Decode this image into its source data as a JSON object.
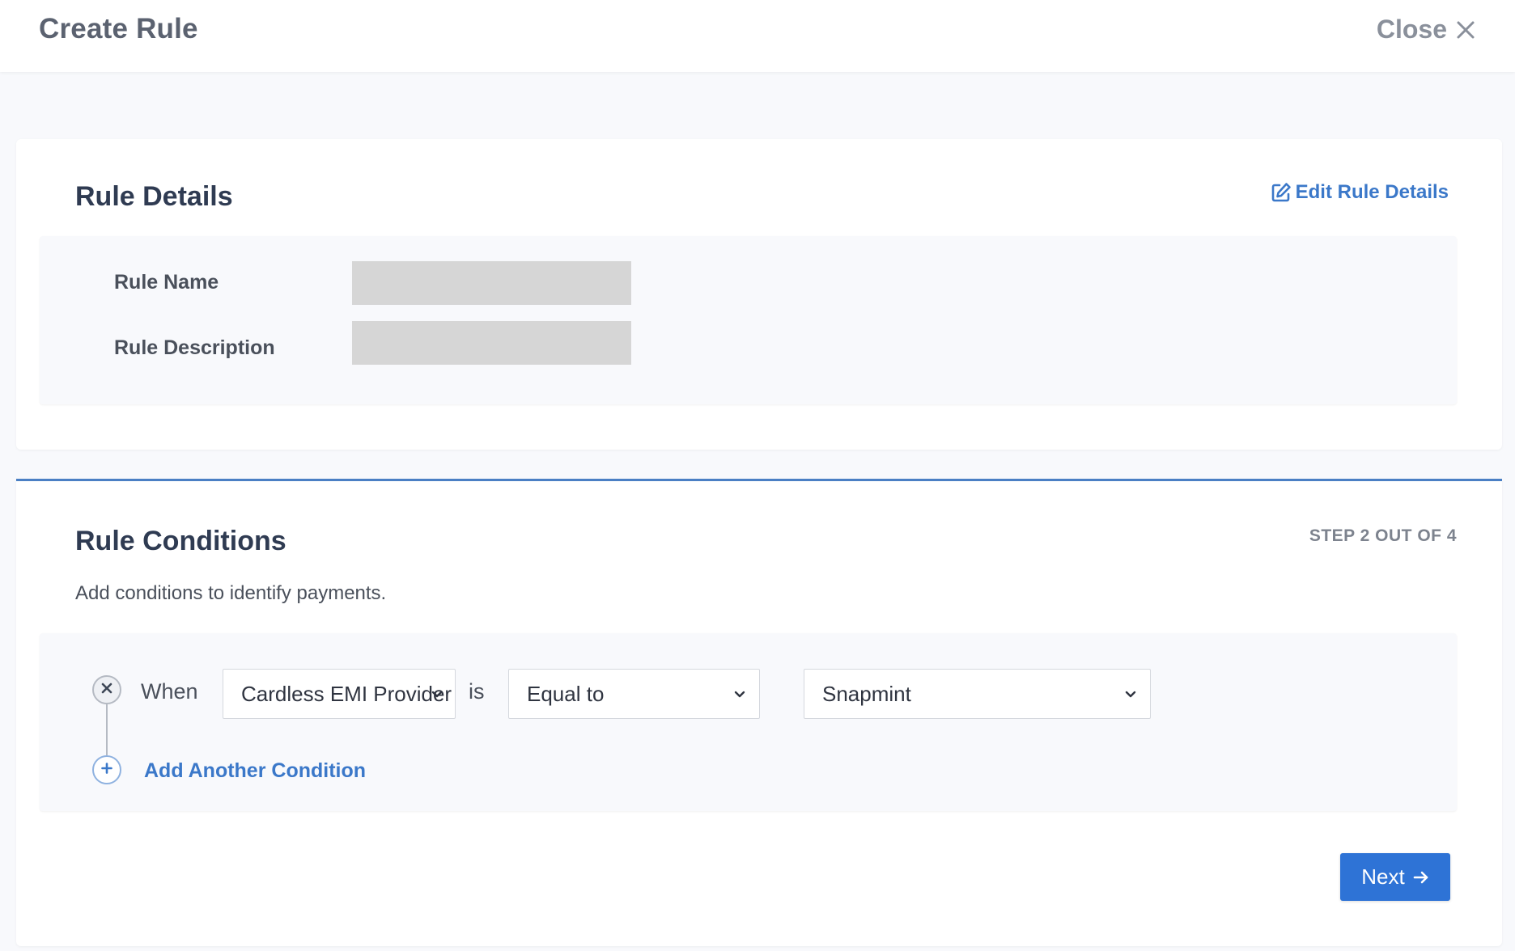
{
  "header": {
    "title": "Create Rule",
    "close_label": "Close",
    "close_icon": "close-icon"
  },
  "rule_details": {
    "title": "Rule Details",
    "edit_label": "Edit Rule Details",
    "edit_icon": "edit-icon",
    "fields": [
      {
        "label": "Rule Name",
        "value": ""
      },
      {
        "label": "Rule Description",
        "value": ""
      }
    ]
  },
  "rule_conditions": {
    "title": "Rule Conditions",
    "step": "STEP 2 OUT OF 4",
    "subtitle": "Add conditions to identify payments.",
    "conditions": [
      {
        "when_label": "When",
        "field": "Cardless EMI Provider",
        "is_label": "is",
        "operator": "Equal to",
        "value": "Snapmint"
      }
    ],
    "add_condition_label": "Add Another Condition"
  },
  "actions": {
    "next_label": "Next"
  },
  "colors": {
    "accent": "#2e73d6",
    "link": "#3b78c9",
    "divider": "#4a7fc4",
    "redacted": "#d6d6d6"
  }
}
